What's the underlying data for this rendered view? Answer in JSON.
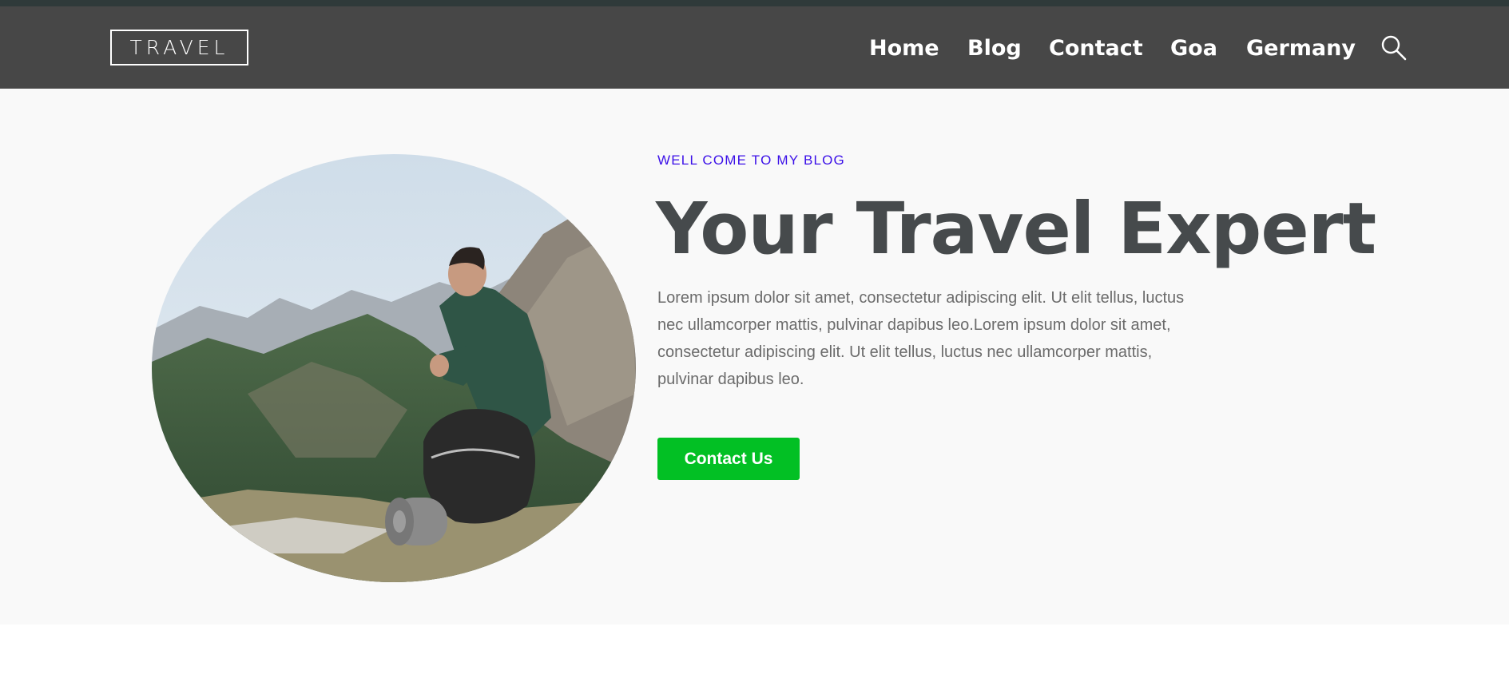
{
  "header": {
    "logo_text": "TRAVEL",
    "nav": [
      {
        "label": "Home"
      },
      {
        "label": "Blog"
      },
      {
        "label": "Contact"
      },
      {
        "label": "Goa"
      },
      {
        "label": "Germany"
      }
    ],
    "search_icon": "search-icon"
  },
  "hero": {
    "eyebrow": "WELL COME TO MY BLOG",
    "title": "Your Travel Expert",
    "body": "Lorem ipsum dolor sit amet, consectetur adipiscing elit. Ut elit tellus, luctus nec ullamcorper mattis, pulvinar dapibus leo.Lorem ipsum dolor sit amet, consectetur adipiscing elit. Ut elit tellus, luctus nec ullamcorper mattis, pulvinar dapibus leo.",
    "cta_label": "Contact Us",
    "image": "hiker-on-mountain-photo"
  },
  "colors": {
    "header_bg": "#474747",
    "top_strip": "#2f3a3a",
    "eyebrow": "#3b10e8",
    "title": "#464a4c",
    "cta": "#02c024",
    "hero_bg": "#f9f9f9"
  }
}
